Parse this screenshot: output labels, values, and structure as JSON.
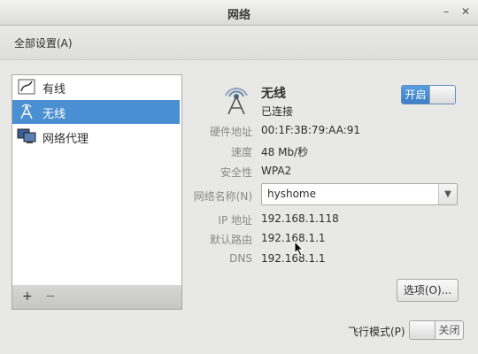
{
  "window": {
    "title": "网络",
    "minimize_glyph": "–",
    "close_glyph": "✕"
  },
  "toolbar": {
    "all_settings": "全部设置(A)"
  },
  "sidebar": {
    "items": [
      {
        "label": "有线",
        "icon": "wired-network-icon",
        "selected": false
      },
      {
        "label": "无线",
        "icon": "wireless-network-icon",
        "selected": true
      },
      {
        "label": "网络代理",
        "icon": "network-proxy-icon",
        "selected": false
      }
    ],
    "add_label": "+",
    "remove_label": "−"
  },
  "detail": {
    "name": "无线",
    "status": "已连接",
    "power_toggle": {
      "label": "开启",
      "state": "on"
    },
    "fields": {
      "hardware_address": {
        "label": "硬件地址",
        "value": "00:1F:3B:79:AA:91"
      },
      "speed": {
        "label": "速度",
        "value": "48 Mb/秒"
      },
      "security": {
        "label": "安全性",
        "value": "WPA2"
      },
      "network_name": {
        "label": "网络名称(N)",
        "value": "hyshome"
      },
      "ip_address": {
        "label": "IP 地址",
        "value": "192.168.1.118"
      },
      "default_route": {
        "label": "默认路由",
        "value": "192.168.1.1"
      },
      "dns": {
        "label": "DNS",
        "value": "192.168.1.1"
      }
    },
    "options_button": "选项(O)..."
  },
  "airplane_mode": {
    "label": "飞行模式(P)",
    "toggle_label": "关闭",
    "state": "off"
  },
  "colors": {
    "accent": "#4a8fd1",
    "window_bg": "#e8e8e7"
  }
}
